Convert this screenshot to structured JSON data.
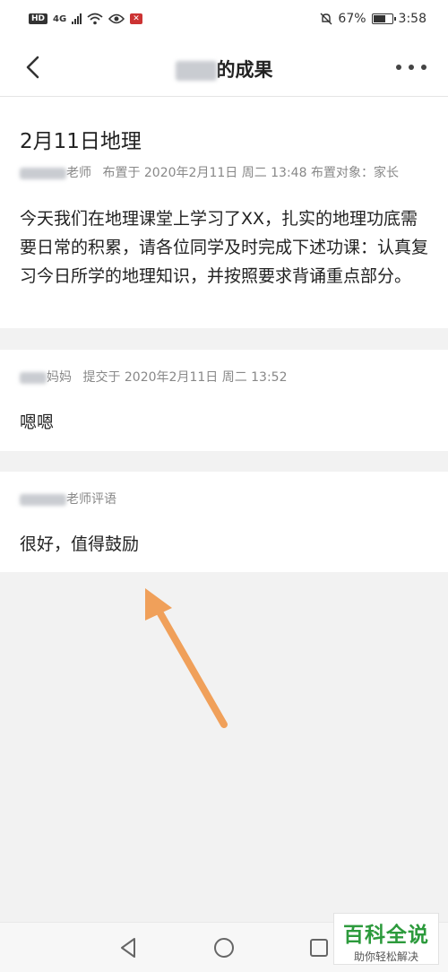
{
  "status_bar": {
    "left_chips": [
      "HD",
      "4G"
    ],
    "battery": "67%",
    "battery_level": 0.67,
    "time": "3:58"
  },
  "nav": {
    "title_suffix": "的成果",
    "back_icon": "chevron-left-icon",
    "more_icon": "more-dots-icon"
  },
  "assignment": {
    "title": "2月11日地理",
    "teacher_suffix": "老师",
    "meta": "布置于 2020年2月11日 周二 13:48 布置对象：家长",
    "body": "今天我们在地理课堂上学习了XX，扎实的地理功底需要日常的积累，请各位同学及时完成下述功课：认真复习今日所学的地理知识，并按照要求背诵重点部分。"
  },
  "submission": {
    "author_suffix": "妈妈",
    "meta": "提交于 2020年2月11日 周二 13:52",
    "content": "嗯嗯"
  },
  "review": {
    "label_suffix": "老师评语",
    "content": "很好，值得鼓励"
  },
  "annotation": {
    "arrow_color": "#f0a05a"
  },
  "system_nav": {
    "back_icon": "triangle-back-icon",
    "home_icon": "circle-home-icon",
    "recent_icon": "square-recent-icon"
  },
  "watermark": {
    "title": "百科全说",
    "subtitle": "助你轻松解决",
    "color": "#2c9a3c"
  }
}
